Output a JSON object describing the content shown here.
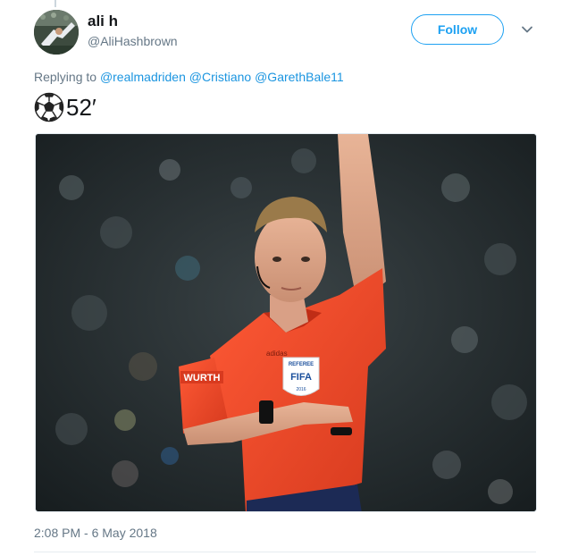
{
  "author": {
    "name": "ali h",
    "handle": "@AliHashbrown"
  },
  "actions": {
    "follow_label": "Follow"
  },
  "replying": {
    "prefix": "Replying to",
    "mentions": [
      "@realmadriden",
      "@Cristiano",
      "@GarethBale11"
    ]
  },
  "tweet": {
    "emoji_icon": "soccer-ball-icon",
    "text": "52′"
  },
  "media": {
    "badge_title": "REFEREE",
    "badge_logo": "FIFA",
    "badge_year": "2016",
    "sleeve_sponsor": "WURTH",
    "chest_brand": "adidas"
  },
  "timestamp": "2:08 PM - 6 May 2018",
  "colors": {
    "accent": "#1da1f2",
    "mention": "#1b95e0",
    "secondary_text": "#657786",
    "kit_orange": "#ef4a2a"
  }
}
